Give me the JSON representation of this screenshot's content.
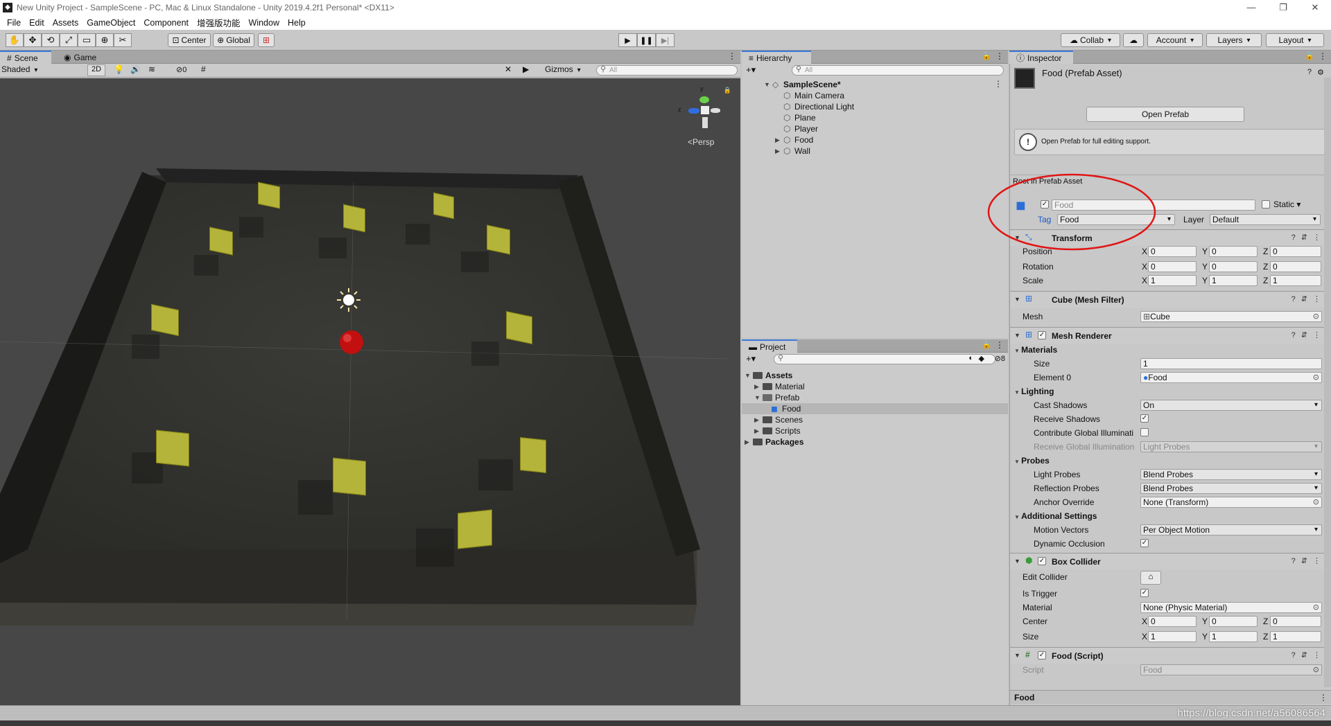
{
  "window": {
    "title": "New Unity Project - SampleScene - PC, Mac & Linux Standalone - Unity 2019.4.2f1 Personal* <DX11>"
  },
  "menu": [
    "File",
    "Edit",
    "Assets",
    "GameObject",
    "Component",
    "增强版功能",
    "Window",
    "Help"
  ],
  "toolbar": {
    "pivot": "Center",
    "space": "Global",
    "collab": "Collab",
    "account": "Account",
    "layers": "Layers",
    "layout": "Layout"
  },
  "scene": {
    "tab_scene": "Scene",
    "tab_game": "Game",
    "shading": "Shaded",
    "mode2d": "2D",
    "fx_count": "0",
    "gizmos": "Gizmos",
    "search_placeholder": "All",
    "persp": "Persp",
    "axis_z": "z",
    "axis_y": "y"
  },
  "hierarchy": {
    "tab": "Hierarchy",
    "search_placeholder": "All",
    "scene_name": "SampleScene*",
    "items": [
      "Main Camera",
      "Directional Light",
      "Plane",
      "Player",
      "Food",
      "Wall"
    ]
  },
  "project": {
    "tab": "Project",
    "hidden_count": "8",
    "assets": "Assets",
    "material": "Material",
    "prefab": "Prefab",
    "food": "Food",
    "scenes": "Scenes",
    "scripts": "Scripts",
    "packages": "Packages"
  },
  "inspector": {
    "tab": "Inspector",
    "asset_title": "Food (Prefab Asset)",
    "open_prefab": "Open Prefab",
    "info": "Open Prefab for full editing support.",
    "root_label": "Root in Prefab Asset",
    "object_name": "Food",
    "static_label": "Static",
    "tag_label": "Tag",
    "tag_value": "Food",
    "layer_label": "Layer",
    "layer_value": "Default",
    "transform": {
      "title": "Transform",
      "position": "Position",
      "rotation": "Rotation",
      "scale": "Scale",
      "pos": [
        "0",
        "0",
        "0"
      ],
      "rot": [
        "0",
        "0",
        "0"
      ],
      "scl": [
        "1",
        "1",
        "1"
      ]
    },
    "mesh_filter": {
      "title": "Cube (Mesh Filter)",
      "mesh_label": "Mesh",
      "mesh_value": "Cube"
    },
    "mesh_renderer": {
      "title": "Mesh Renderer",
      "materials": "Materials",
      "size_label": "Size",
      "size_value": "1",
      "element0_label": "Element 0",
      "element0_value": "Food",
      "lighting": "Lighting",
      "cast_shadows": "Cast Shadows",
      "cast_value": "On",
      "receive_shadows": "Receive Shadows",
      "contribute_gi": "Contribute Global Illuminati",
      "receive_gi": "Receive Global Illumination",
      "receive_gi_value": "Light Probes",
      "probes": "Probes",
      "light_probes": "Light Probes",
      "light_probes_value": "Blend Probes",
      "reflection_probes": "Reflection Probes",
      "reflection_value": "Blend Probes",
      "anchor_override": "Anchor Override",
      "anchor_value": "None (Transform)",
      "additional": "Additional Settings",
      "motion_vectors": "Motion Vectors",
      "motion_value": "Per Object Motion",
      "dynamic_occlusion": "Dynamic Occlusion"
    },
    "box_collider": {
      "title": "Box Collider",
      "edit_collider": "Edit Collider",
      "is_trigger": "Is Trigger",
      "material_label": "Material",
      "material_value": "None (Physic Material)",
      "center_label": "Center",
      "center": [
        "0",
        "0",
        "0"
      ],
      "size_label": "Size",
      "size": [
        "1",
        "1",
        "1"
      ]
    },
    "food_script": {
      "title": "Food (Script)",
      "script_label": "Script",
      "script_value": "Food"
    },
    "footer": "Food"
  },
  "watermark": "https://blog.csdn.net/a56086564",
  "colors": {
    "accent": "#3a79d9",
    "annotation": "#e01515",
    "food_cube": "#b5b43a"
  }
}
